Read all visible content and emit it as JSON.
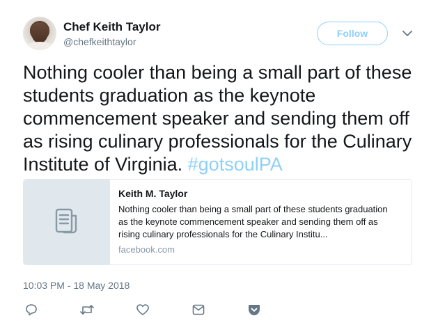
{
  "author": {
    "name": "Chef Keith Taylor",
    "handle": "@chefkeithtaylor"
  },
  "follow_button": {
    "label": "Follow"
  },
  "tweet": {
    "text": "Nothing cooler than being a small part of these students graduation as the keynote commencement speaker and sending them off as rising culinary professionals for the Culinary Institute of Virginia. ",
    "hashtag": "#gotsoulPA",
    "timestamp": "10:03 PM - 18 May 2018"
  },
  "card": {
    "title": "Keith M. Taylor",
    "description": "Nothing cooler than being a small part of these students graduation as the keynote commencement speaker and sending them off as rising culinary professionals for the Culinary Institu...",
    "domain": "facebook.com",
    "icon": "document-icon"
  },
  "actions": [
    "reply-icon",
    "retweet-icon",
    "like-icon",
    "direct-message-icon",
    "pocket-icon"
  ],
  "colors": {
    "accent": "#8ed0f9",
    "text": "#14171a",
    "muted": "#657786",
    "card_media": "#e1e8ed"
  }
}
